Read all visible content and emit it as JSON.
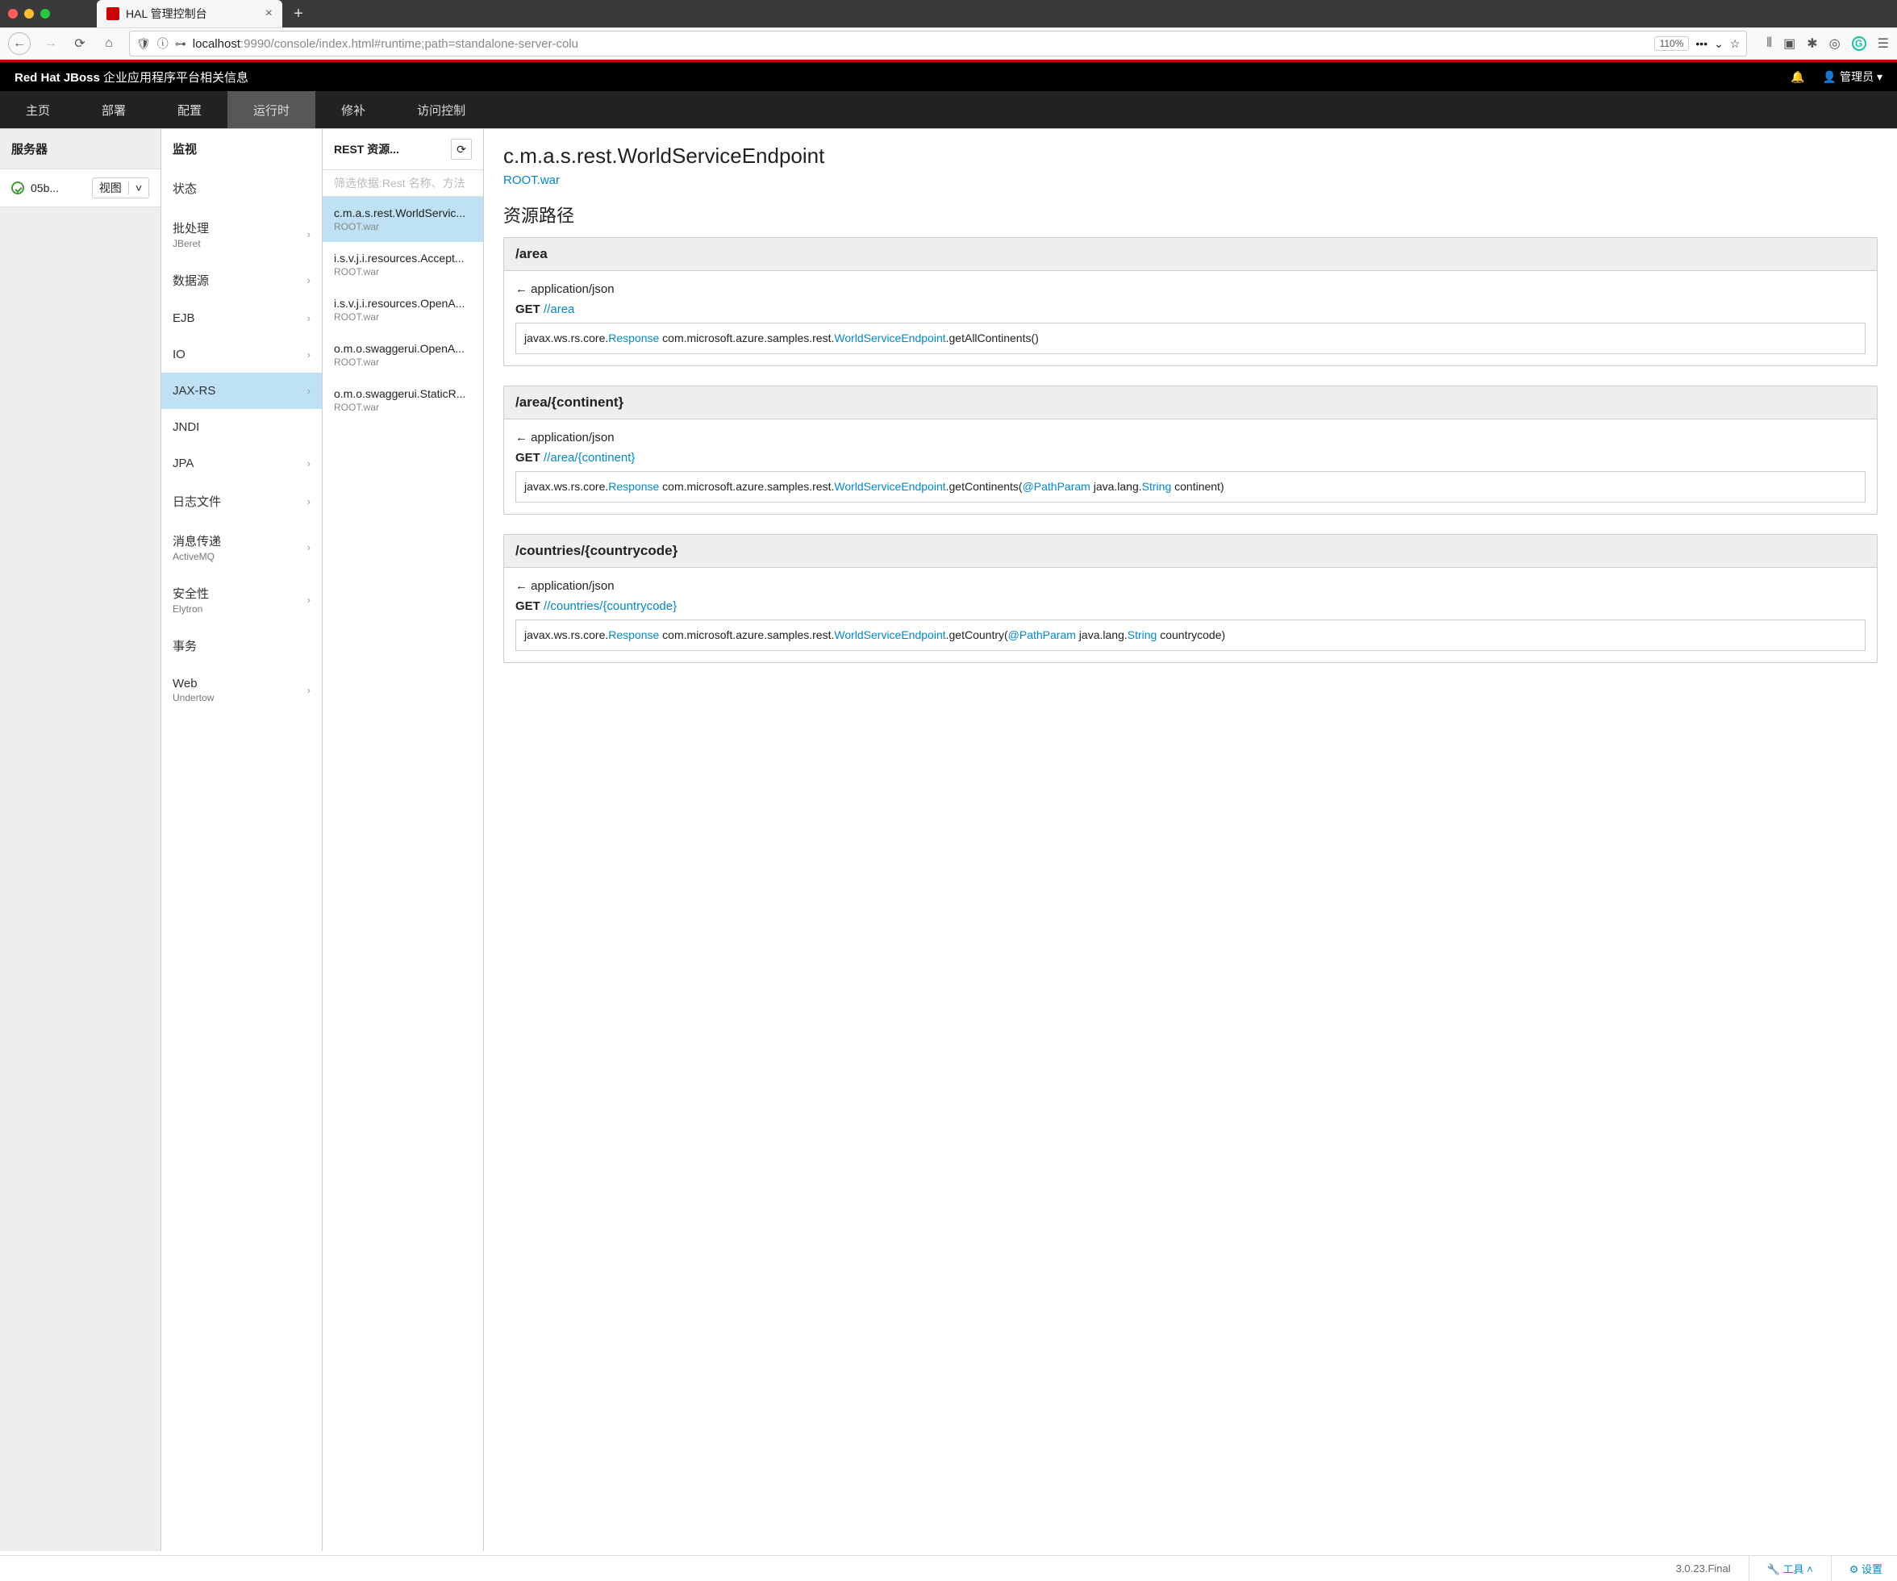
{
  "browser": {
    "tab_title": "HAL 管理控制台",
    "url_host": "localhost",
    "url_path": ":9990/console/index.html#runtime;path=standalone-server-colu",
    "zoom": "110%"
  },
  "app": {
    "brand_bold": "Red Hat JBoss",
    "brand_rest": " 企业应用程序平台相关信息",
    "user_label": "管理员"
  },
  "nav": [
    "主页",
    "部署",
    "配置",
    "运行时",
    "修补",
    "访问控制"
  ],
  "nav_active": 3,
  "col1": {
    "title": "服务器",
    "server": "05b...",
    "view": "视图"
  },
  "col2": {
    "title": "监视",
    "items": [
      {
        "label": "状态",
        "sub": ""
      },
      {
        "label": "批处理",
        "sub": "JBeret",
        "chev": true
      },
      {
        "label": "数据源",
        "sub": "",
        "chev": true
      },
      {
        "label": "EJB",
        "sub": "",
        "chev": true
      },
      {
        "label": "IO",
        "sub": "",
        "chev": true
      },
      {
        "label": "JAX-RS",
        "sub": "",
        "chev": true,
        "selected": true
      },
      {
        "label": "JNDI",
        "sub": ""
      },
      {
        "label": "JPA",
        "sub": "",
        "chev": true
      },
      {
        "label": "日志文件",
        "sub": "",
        "chev": true
      },
      {
        "label": "消息传递",
        "sub": "ActiveMQ",
        "chev": true
      },
      {
        "label": "安全性",
        "sub": "Elytron",
        "chev": true
      },
      {
        "label": "事务",
        "sub": ""
      },
      {
        "label": "Web",
        "sub": "Undertow",
        "chev": true
      }
    ]
  },
  "col3": {
    "title": "REST 资源...",
    "filter_placeholder": "筛选依据:Rest 名称、方法",
    "items": [
      {
        "name": "c.m.a.s.rest.WorldServic...",
        "war": "ROOT.war",
        "selected": true
      },
      {
        "name": "i.s.v.j.i.resources.Accept...",
        "war": "ROOT.war"
      },
      {
        "name": "i.s.v.j.i.resources.OpenA...",
        "war": "ROOT.war"
      },
      {
        "name": "o.m.o.swaggerui.OpenA...",
        "war": "ROOT.war"
      },
      {
        "name": "o.m.o.swaggerui.StaticR...",
        "war": "ROOT.war"
      }
    ]
  },
  "detail": {
    "heading": "c.m.a.s.rest.WorldServiceEndpoint",
    "deployment": "ROOT.war",
    "section": "资源路径",
    "paths": [
      {
        "path": "/area",
        "consumes": "← application/json",
        "verb": "GET",
        "link": "//area",
        "sig_pre": "javax.ws.rs.core.",
        "sig_type1": "Response",
        "sig_mid": " com.microsoft.azure.samples.rest.",
        "sig_type2": "WorldServiceEndpoint",
        "sig_tail": ".getAllContinents()"
      },
      {
        "path": "/area/{continent}",
        "consumes": "← application/json",
        "verb": "GET",
        "link": "//area/{continent}",
        "sig_pre": "javax.ws.rs.core.",
        "sig_type1": "Response",
        "sig_mid": " com.microsoft.azure.samples.rest.",
        "sig_type2": "WorldServiceEndpoint",
        "sig_method": ".getContinents(",
        "sig_ann": "@PathParam",
        "sig_argtype_pre": " java.lang.",
        "sig_argtype": "String",
        "sig_tail": " continent)"
      },
      {
        "path": "/countries/{countrycode}",
        "consumes": "← application/json",
        "verb": "GET",
        "link": "//countries/{countrycode}",
        "sig_pre": "javax.ws.rs.core.",
        "sig_type1": "Response",
        "sig_mid": " com.microsoft.azure.samples.rest.",
        "sig_type2": "WorldServiceEndpoint",
        "sig_method": ".getCountry(",
        "sig_ann": "@PathParam",
        "sig_argtype_pre": " java.lang.",
        "sig_argtype": "String",
        "sig_tail": " countrycode)"
      }
    ]
  },
  "footer": {
    "version": "3.0.23.Final",
    "tools": "工具",
    "settings": "设置"
  }
}
